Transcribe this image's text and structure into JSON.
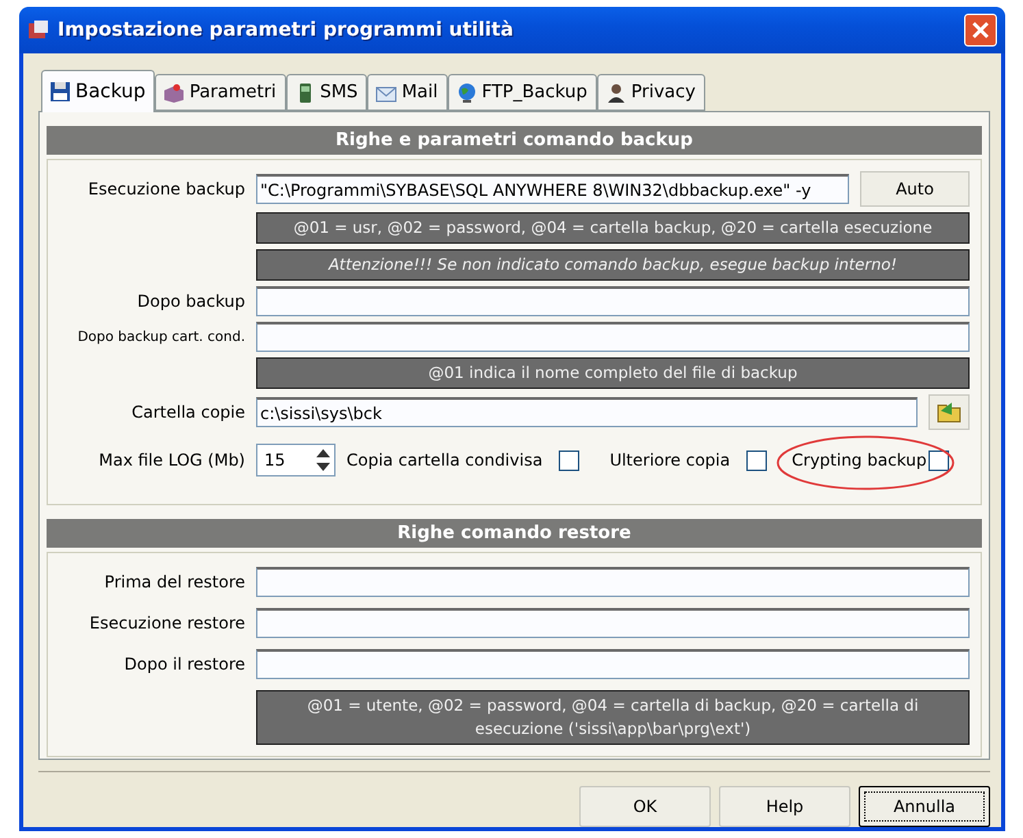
{
  "window": {
    "title": "Impostazione parametri programmi utilità"
  },
  "tabs": [
    {
      "label": "Backup",
      "kind": "floppy",
      "selected": true
    },
    {
      "label": "Parametri",
      "kind": "box",
      "selected": false
    },
    {
      "label": "SMS",
      "kind": "phone",
      "selected": false
    },
    {
      "label": "Mail",
      "kind": "mail",
      "selected": false
    },
    {
      "label": "FTP_Backup",
      "kind": "globe",
      "selected": false
    },
    {
      "label": "Privacy",
      "kind": "person",
      "selected": false
    }
  ],
  "backup_section": {
    "title": "Righe e parametri comando backup",
    "rows": [
      {
        "kind": "field",
        "label": "Esecuzione backup",
        "value": "\"C:\\Programmi\\SYBASE\\SQL ANYWHERE 8\\WIN32\\dbbackup.exe\" -y",
        "button": "Auto"
      },
      {
        "kind": "note",
        "text": "@01 = usr, @02 = password, @04 = cartella backup, @20 = cartella esecuzione"
      },
      {
        "kind": "warning",
        "text": "Attenzione!!! Se non indicato comando backup, esegue backup interno!"
      },
      {
        "kind": "field",
        "label": "Dopo backup",
        "value": ""
      },
      {
        "kind": "field",
        "label": "Dopo backup cart. cond.",
        "value": "",
        "small": true
      },
      {
        "kind": "note",
        "text": "@01 indica il nome completo del file di backup"
      },
      {
        "kind": "folder",
        "label": "Cartella copie",
        "value": "c:\\sissi\\sys\\bck"
      }
    ],
    "log": {
      "label": "Max file LOG (Mb)",
      "value": "15"
    },
    "checks": [
      {
        "label": "Copia cartella condivisa",
        "checked": false
      },
      {
        "label": "Ulteriore copia",
        "checked": false
      },
      {
        "label": "Crypting backup",
        "checked": false,
        "circled": true
      }
    ]
  },
  "restore_section": {
    "title": "Righe comando restore",
    "rows": [
      {
        "kind": "field",
        "label": "Prima del restore",
        "value": ""
      },
      {
        "kind": "field",
        "label": "Esecuzione restore",
        "value": ""
      },
      {
        "kind": "field",
        "label": "Dopo il restore",
        "value": ""
      },
      {
        "kind": "note",
        "text": "@01 = utente, @02 = password, @04 = cartella di backup, @20 = cartella di esecuzione ('sissi\\app\\bar\\prg\\ext')"
      }
    ]
  },
  "buttons": [
    {
      "label": "OK",
      "focused": false
    },
    {
      "label": "Help",
      "focused": false
    },
    {
      "label": "Annulla",
      "focused": true
    }
  ]
}
